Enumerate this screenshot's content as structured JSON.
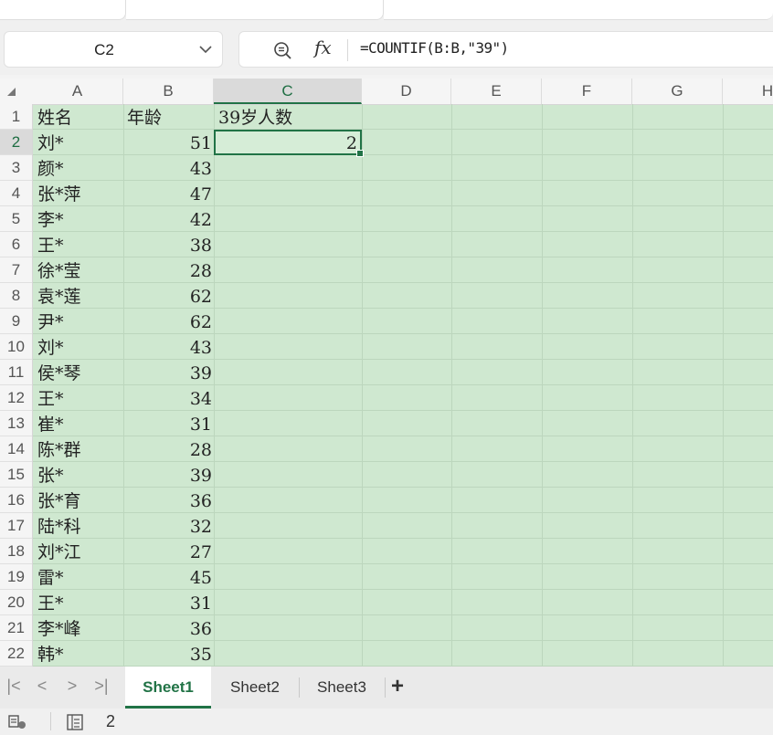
{
  "formula_bar": {
    "cell_reference": "C2",
    "formula": "=COUNTIF(B:B,\"39\")"
  },
  "columns": [
    "A",
    "B",
    "C",
    "D",
    "E",
    "F",
    "G",
    "H"
  ],
  "rows": [
    "1",
    "2",
    "3",
    "4",
    "5",
    "6",
    "7",
    "8",
    "9",
    "10",
    "11",
    "12",
    "13",
    "14",
    "15",
    "16",
    "17",
    "18",
    "19",
    "20",
    "21",
    "22"
  ],
  "sheet": {
    "headers": {
      "a": "姓名",
      "b": "年龄",
      "c": "39岁人数"
    },
    "c2_value": "2",
    "names": [
      "刘*",
      "颜*",
      "张*萍",
      "李*",
      "王*",
      "徐*莹",
      "袁*莲",
      "尹*",
      "刘*",
      "侯*琴",
      "王*",
      "崔*",
      "陈*群",
      "张*",
      "张*育",
      "陆*科",
      "刘*江",
      "雷*",
      "王*",
      "李*峰",
      "韩*"
    ],
    "ages": [
      "51",
      "43",
      "47",
      "42",
      "38",
      "28",
      "62",
      "62",
      "43",
      "39",
      "34",
      "31",
      "28",
      "39",
      "36",
      "32",
      "27",
      "45",
      "31",
      "36",
      "35"
    ]
  },
  "tabs": {
    "sheet1": "Sheet1",
    "sheet2": "Sheet2",
    "sheet3": "Sheet3",
    "active": "Sheet1"
  },
  "status_bar": {
    "value": "2"
  },
  "colors": {
    "accent": "#217346",
    "grid_fill": "#cfe8d0",
    "grid_line": "#bcd6bd"
  }
}
